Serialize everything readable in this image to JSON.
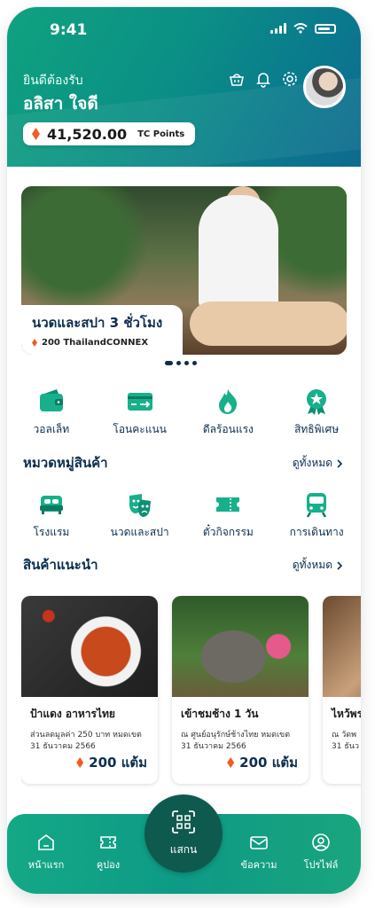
{
  "status": {
    "time": "9:41"
  },
  "header": {
    "greeting": "ยินดีต้องรับ",
    "user_name": "อลิสา ใจดี",
    "points_value": "41,520.00",
    "points_unit": "TC Points"
  },
  "banner": {
    "title": "นวดและสปา 3 ชั่วโมง",
    "subtitle": "200 ThailandCONNEX",
    "slide_index": 1,
    "slide_count": 4
  },
  "quick_actions": [
    "วอลเล็ท",
    "โอนคะแนน",
    "ดีลร้อนแรง",
    "สิทธิพิเศษ"
  ],
  "categories": {
    "title": "หมวดหมู่สินค้า",
    "more": "ดูทั้งหมด",
    "items": [
      "โรงแรม",
      "นวดและสปา",
      "ตั๋วกิจกรรม",
      "การเดินทาง"
    ]
  },
  "recommended": {
    "title": "สินค้าแนะนำ",
    "more": "ดูทั้งหมด",
    "items": [
      {
        "title": "ป้าแดง อาหารไทย",
        "desc1": "ส่วนลดมูลค่า 250 บาท หมดเขต",
        "desc2": "31 ธันวาคม 2566",
        "price": "200 แต้ม"
      },
      {
        "title": "เข้าชมช้าง 1 วัน",
        "desc1": "ณ ศูนย์อนุรักษ์ช้างไทย หมดเขต",
        "desc2": "31 ธันวาคม 2566",
        "price": "200 แต้ม"
      },
      {
        "title": "ไหว้พร",
        "desc1": "ณ วัดพ",
        "desc2": "31 ธันว",
        "price": ""
      }
    ]
  },
  "bottom_nav": {
    "home": "หน้าแรก",
    "coupon": "คูปอง",
    "scan": "แสกน",
    "messages": "ข้อความ",
    "profile": "โปรไฟล์"
  },
  "colors": {
    "brand": "#0fa27f",
    "navy": "#0c2e4f",
    "accent": "#f25c22"
  }
}
